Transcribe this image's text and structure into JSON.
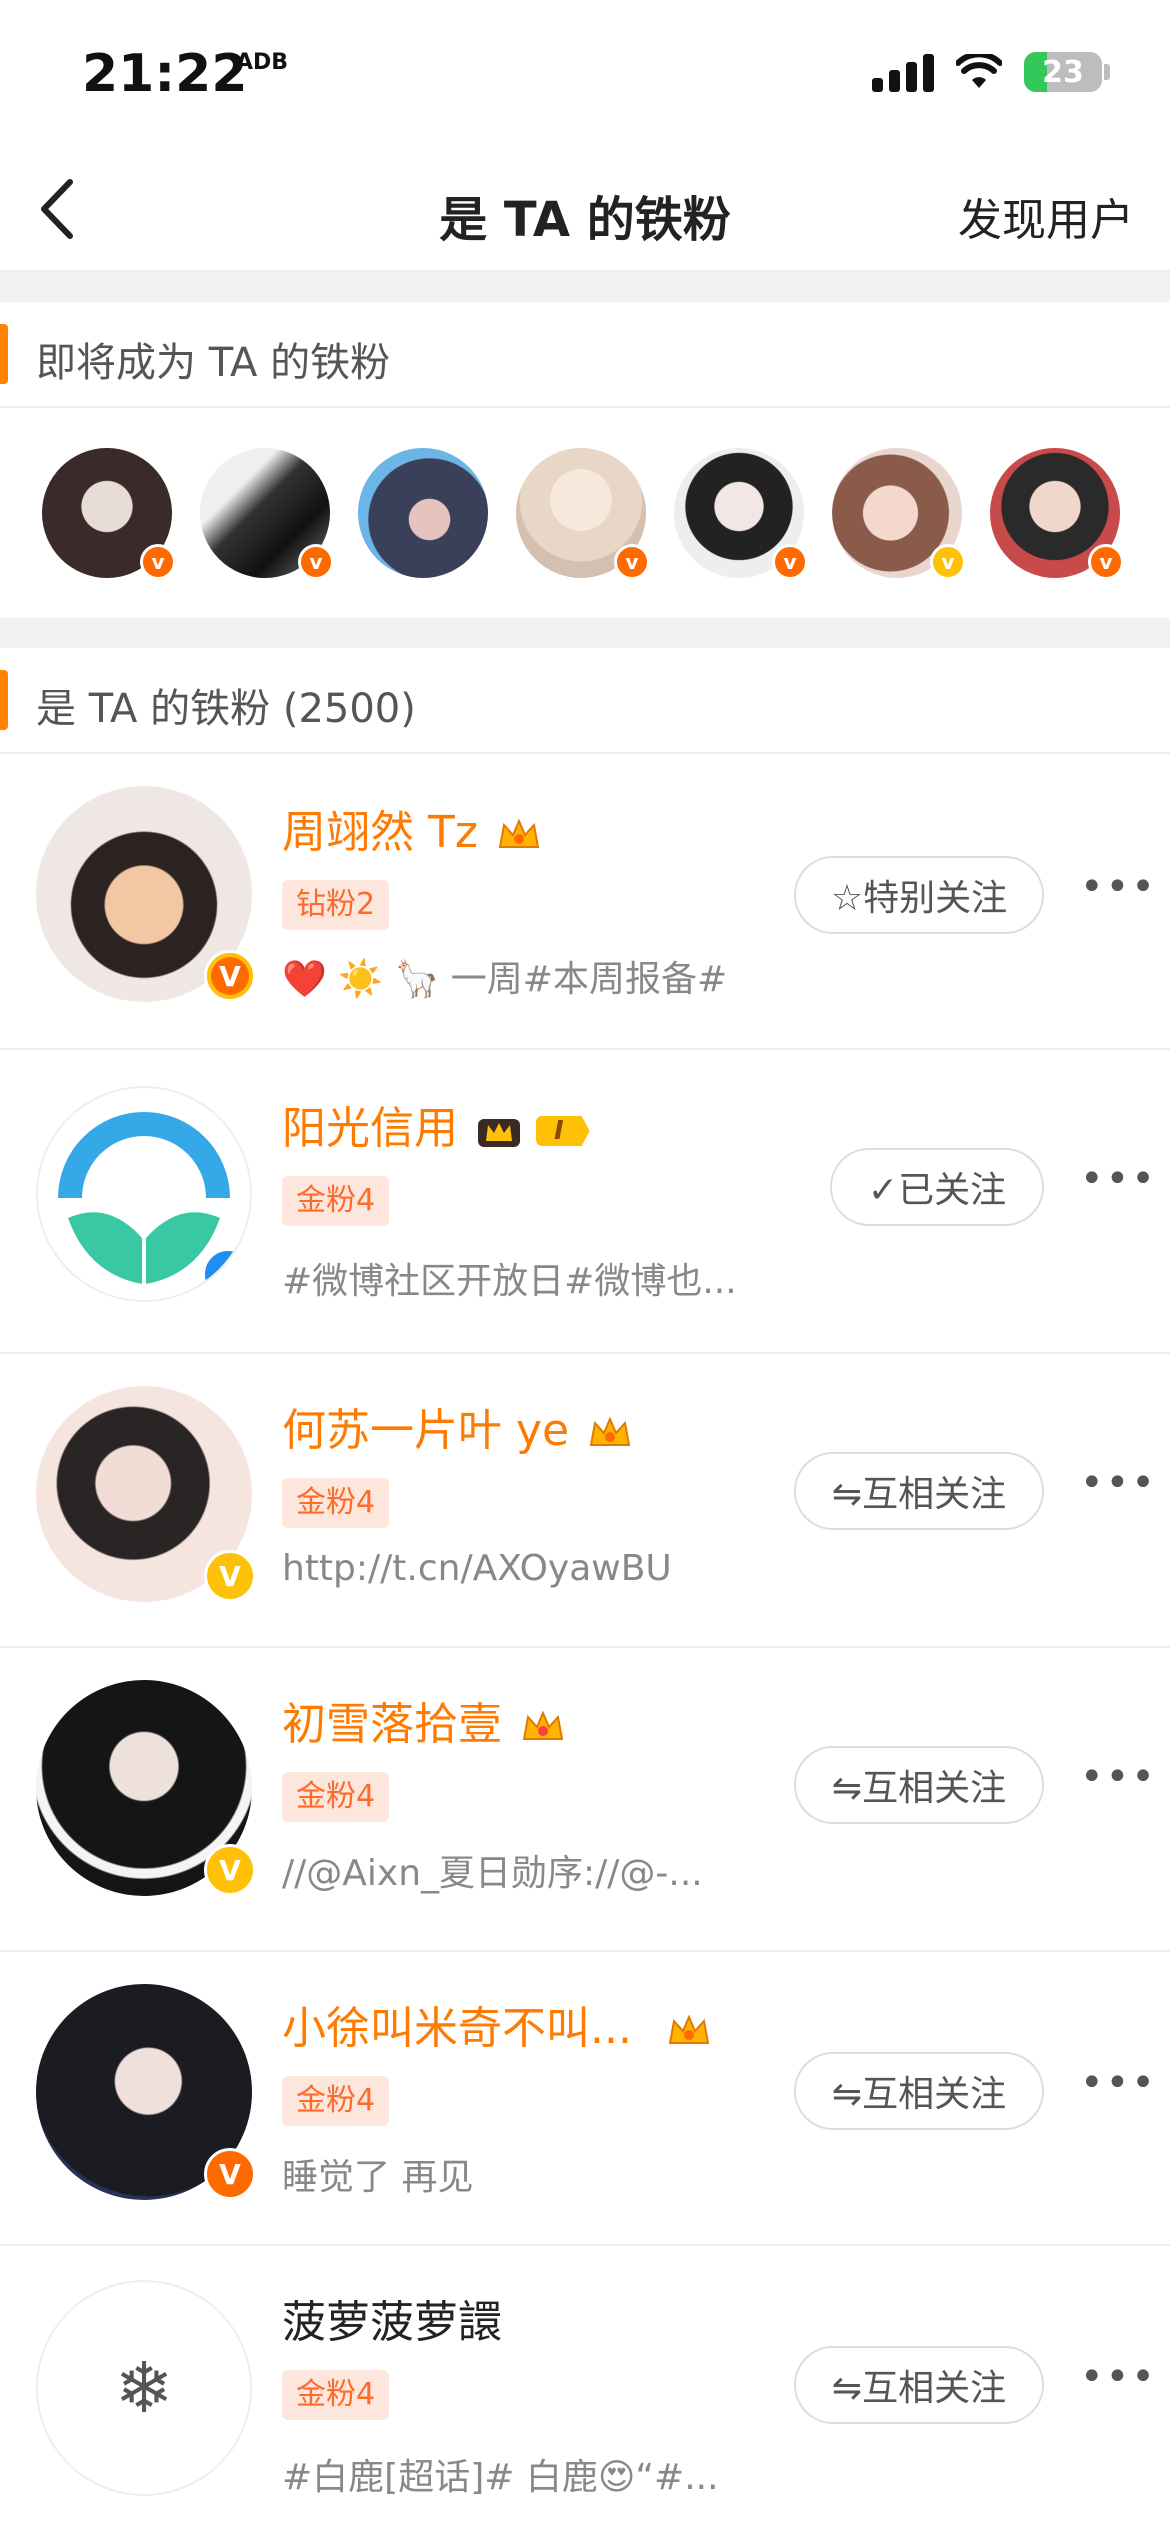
{
  "status": {
    "time": "21:22",
    "battery": "23",
    "app_badge": "ADB"
  },
  "nav": {
    "title": "是 TA 的铁粉",
    "right_link": "发现用户"
  },
  "upcoming": {
    "header": "即将成为 TA 的铁粉"
  },
  "fans": {
    "header": "是 TA 的铁粉 (2500)",
    "items": [
      {
        "name": "周翊然 Tz",
        "tag": "钻粉2",
        "desc": "❤️ ☀️ 🦙 一周#本周报备#",
        "button": "☆特别关注",
        "badge": "V"
      },
      {
        "name": "阳光信用",
        "tag": "金粉4",
        "desc": "#微博社区开放日#微博也...",
        "button": "✓已关注",
        "badge": "V",
        "level": "I"
      },
      {
        "name": "何苏一片叶 ye",
        "tag": "金粉4",
        "desc": "http://t.cn/AXOyawBU",
        "button": "⇋互相关注",
        "badge": "V"
      },
      {
        "name": "初雪落拾壹",
        "tag": "金粉4",
        "desc": "//@Aixn_夏日勋序://@-...",
        "button": "⇋互相关注",
        "badge": "V"
      },
      {
        "name": "小徐叫米奇不叫...",
        "tag": "金粉4",
        "desc": "睡觉了 再见",
        "button": "⇋互相关注",
        "badge": "V"
      },
      {
        "name": "菠萝菠萝譞",
        "tag": "金粉4",
        "desc": "#白鹿[超话]# 白鹿😍“#...",
        "button": "⇋互相关注"
      }
    ]
  },
  "colors": {
    "accent": "#ff8200",
    "name": "#ff7a00",
    "badge_orange": "#ff6a00",
    "badge_yellow": "#ffc107",
    "badge_blue": "#1e8ff0"
  }
}
